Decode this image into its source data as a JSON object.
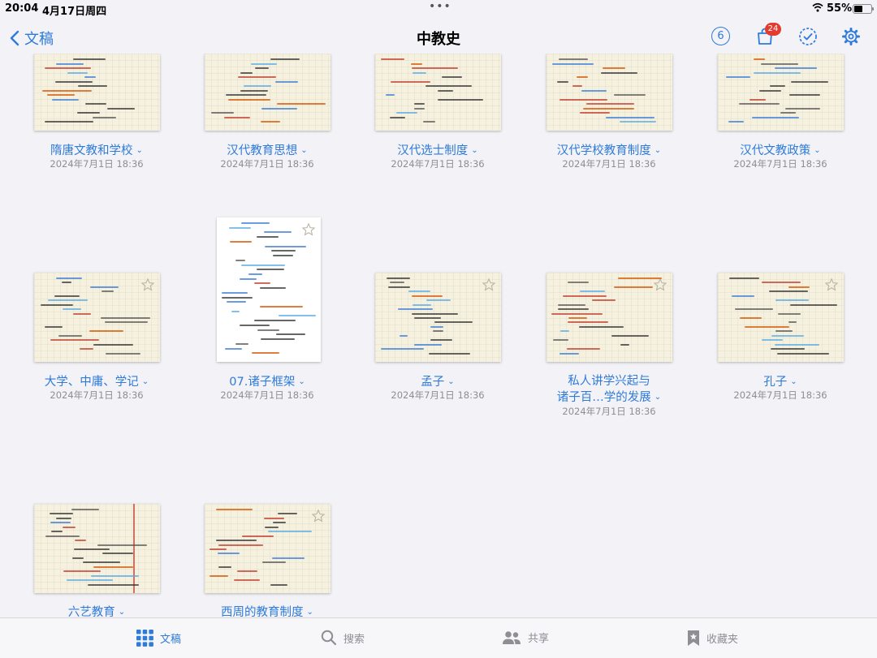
{
  "status": {
    "time": "20:04",
    "date": "4月17日周四",
    "dots": "•••",
    "battery": "55%",
    "battery_level": 0.55
  },
  "nav": {
    "back_label": "文稿",
    "title": "中教史",
    "count": "6",
    "badge": "24"
  },
  "colors": {
    "accent": "#2f7bd9",
    "badge": "#e33b2f",
    "paper": "#f5f1de"
  },
  "documents": [
    {
      "title": "隋唐文教和学校",
      "date": "2024年7月1日 18:36"
    },
    {
      "title": "汉代教育思想",
      "date": "2024年7月1日 18:36"
    },
    {
      "title": "汉代选士制度",
      "date": "2024年7月1日 18:36"
    },
    {
      "title": "汉代学校教育制度",
      "date": "2024年7月1日 18:36"
    },
    {
      "title": "汉代文教政策",
      "date": "2024年7月1日 18:36"
    },
    {
      "title": "大学、中庸、学记",
      "date": "2024年7月1日 18:36"
    },
    {
      "title": "07.诸子框架",
      "date": "2024年7月1日 18:36"
    },
    {
      "title": "孟子",
      "date": "2024年7月1日 18:36"
    },
    {
      "title_line1": "私人讲学兴起与",
      "title_line2": "诸子百…学的发展",
      "date": "2024年7月1日 18:36"
    },
    {
      "title": "孔子",
      "date": "2024年7月1日 18:36"
    },
    {
      "title": "六艺教育"
    },
    {
      "title": "西周的教育制度"
    }
  ],
  "tabs": [
    {
      "label": "文稿",
      "icon": "grid-icon"
    },
    {
      "label": "搜索",
      "icon": "search-icon"
    },
    {
      "label": "共享",
      "icon": "people-icon"
    },
    {
      "label": "收藏夹",
      "icon": "bookmark-icon"
    }
  ]
}
